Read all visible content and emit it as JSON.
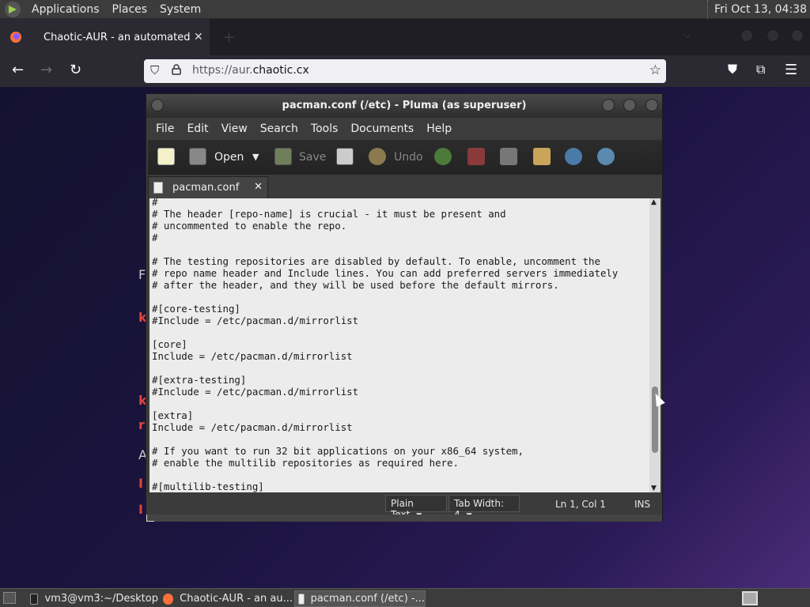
{
  "top_panel": {
    "menus": [
      "Applications",
      "Places",
      "System"
    ],
    "clock": "Fri Oct 13, 04:38"
  },
  "browser": {
    "tab_title": "Chaotic-AUR - an automated bu",
    "tab_close": "✕",
    "new_tab": "+",
    "url_host": "https://aur.",
    "url_domain": "chaotic.cx",
    "icons": [
      "back-icon",
      "forward-icon",
      "reload-icon",
      "shield-icon",
      "lock-icon",
      "star-icon",
      "pocket-icon",
      "extensions-icon",
      "menu-icon"
    ]
  },
  "pluma": {
    "title": "pacman.conf (/etc) - Pluma (as superuser)",
    "menus": [
      "File",
      "Edit",
      "View",
      "Search",
      "Tools",
      "Documents",
      "Help"
    ],
    "toolbar": {
      "open_label": "Open",
      "save_label": "Save",
      "undo_label": "Undo"
    },
    "doc_tab": "pacman.conf",
    "doc_tab_close": "✕",
    "content": "#\n# The header [repo-name] is crucial - it must be present and\n# uncommented to enable the repo.\n#\n\n# The testing repositories are disabled by default. To enable, uncomment the\n# repo name header and Include lines. You can add preferred servers immediately\n# after the header, and they will be used before the default mirrors.\n\n#[core-testing]\n#Include = /etc/pacman.d/mirrorlist\n\n[core]\nInclude = /etc/pacman.d/mirrorlist\n\n#[extra-testing]\n#Include = /etc/pacman.d/mirrorlist\n\n[extra]\nInclude = /etc/pacman.d/mirrorlist\n\n# If you want to run 32 bit applications on your x86_64 system,\n# enable the multilib repositories as required here.\n\n#[multilib-testing]\n#Include = /etc/pacman.d/mirrorlist",
    "status": {
      "language": "Plain Text",
      "tab_width": "Tab Width:  4",
      "position": "Ln 1, Col 1",
      "mode": "INS"
    }
  },
  "taskbar": {
    "tasks": [
      "vm3@vm3:~/Desktop",
      "Chaotic-AUR - an au...",
      "pacman.conf (/etc) -..."
    ]
  },
  "colors": {
    "accent_red": "#e0443a",
    "editor_bg": "#ececec"
  }
}
